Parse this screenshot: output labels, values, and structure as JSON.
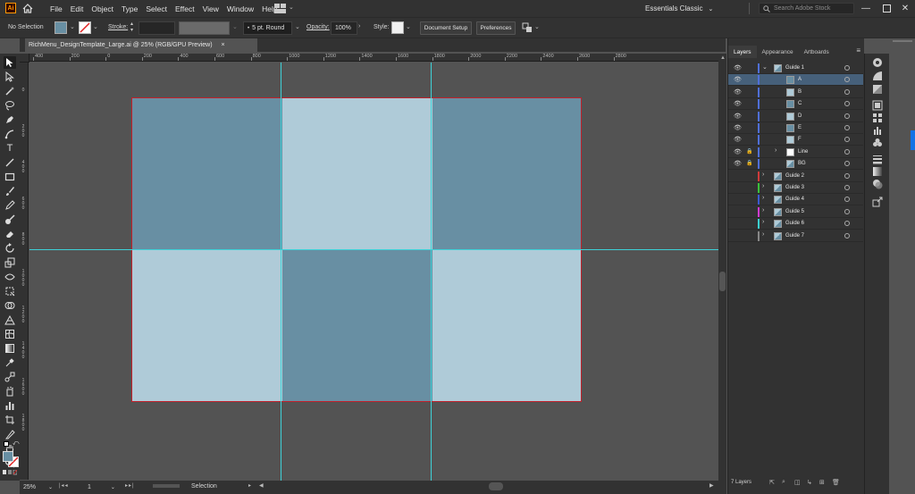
{
  "app": {
    "logo_text": "Ai"
  },
  "menu": {
    "items": [
      "File",
      "Edit",
      "Object",
      "Type",
      "Select",
      "Effect",
      "View",
      "Window",
      "Help"
    ]
  },
  "workspace": {
    "label": "Essentials Classic"
  },
  "search": {
    "placeholder": "Search Adobe Stock"
  },
  "control_bar": {
    "selection_label": "No Selection",
    "stroke_label": "Stroke:",
    "brush_value": "5 pt. Round",
    "opacity_label": "Opacity:",
    "opacity_value": "100%",
    "style_label": "Style:",
    "document_setup_label": "Document Setup",
    "preferences_label": "Preferences"
  },
  "document": {
    "tab_title": "RichMenu_DesignTemplate_Large.ai @ 25% (RGB/GPU Preview)",
    "close_glyph": "×"
  },
  "ruler": {
    "top_labels": [
      "400",
      "200",
      "0",
      "200",
      "400",
      "600",
      "800",
      "1000",
      "1200",
      "1400",
      "1600",
      "1800",
      "2000",
      "2200",
      "2400",
      "2600",
      "2800"
    ],
    "left_labels": [
      "0",
      "2 0 0",
      "4 0 0",
      "6 0 0",
      "8 0 0",
      "1 0 0 0",
      "1 2 0 0",
      "1 4 0 0",
      "1 6 0 0",
      "1 8 0 0"
    ]
  },
  "colors": {
    "dark_cell": "#688fa3",
    "light_cell": "#afcbd8",
    "guide": "#3ed2d8",
    "artboard_border": "#c0202a",
    "selected_row": "#46607a"
  },
  "status": {
    "zoom": "25%",
    "page": "1",
    "tool_name": "Selection"
  },
  "panel": {
    "tabs": [
      "Layers",
      "Appearance",
      "Artboards"
    ],
    "layers": [
      {
        "name": "Guide 1",
        "level": 0,
        "expanded": true,
        "visible": true,
        "locked": false,
        "color": "#4f6fd8",
        "thumb": "guide"
      },
      {
        "name": "A",
        "level": 1,
        "visible": true,
        "locked": false,
        "color": "#4f6fd8",
        "thumb": "#688fa3",
        "selected": true
      },
      {
        "name": "B",
        "level": 1,
        "visible": true,
        "locked": false,
        "color": "#4f6fd8",
        "thumb": "#afcbd8"
      },
      {
        "name": "C",
        "level": 1,
        "visible": true,
        "locked": false,
        "color": "#4f6fd8",
        "thumb": "#688fa3"
      },
      {
        "name": "D",
        "level": 1,
        "visible": true,
        "locked": false,
        "color": "#4f6fd8",
        "thumb": "#afcbd8"
      },
      {
        "name": "E",
        "level": 1,
        "visible": true,
        "locked": false,
        "color": "#4f6fd8",
        "thumb": "#688fa3"
      },
      {
        "name": "F",
        "level": 1,
        "visible": true,
        "locked": false,
        "color": "#4f6fd8",
        "thumb": "#afcbd8"
      },
      {
        "name": "Line",
        "level": 1,
        "expanded": false,
        "visible": true,
        "locked": true,
        "color": "#4f6fd8",
        "thumb": "#ffffff"
      },
      {
        "name": "BG",
        "level": 1,
        "visible": true,
        "locked": true,
        "color": "#4f6fd8",
        "thumb": "guide"
      },
      {
        "name": "Guide 2",
        "level": 0,
        "expanded": false,
        "visible": false,
        "locked": false,
        "color": "#d03a3a",
        "thumb": "guide"
      },
      {
        "name": "Guide 3",
        "level": 0,
        "expanded": false,
        "visible": false,
        "locked": false,
        "color": "#3ac03a",
        "thumb": "guide"
      },
      {
        "name": "Guide 4",
        "level": 0,
        "expanded": false,
        "visible": false,
        "locked": false,
        "color": "#3a5ad0",
        "thumb": "guide"
      },
      {
        "name": "Guide 5",
        "level": 0,
        "expanded": false,
        "visible": false,
        "locked": false,
        "color": "#d03ad0",
        "thumb": "guide"
      },
      {
        "name": "Guide 6",
        "level": 0,
        "expanded": false,
        "visible": false,
        "locked": false,
        "color": "#3ad0d0",
        "thumb": "guide"
      },
      {
        "name": "Guide 7",
        "level": 0,
        "expanded": false,
        "visible": false,
        "locked": false,
        "color": "#888888",
        "thumb": "guide"
      }
    ],
    "layer_count": "7 Layers"
  }
}
